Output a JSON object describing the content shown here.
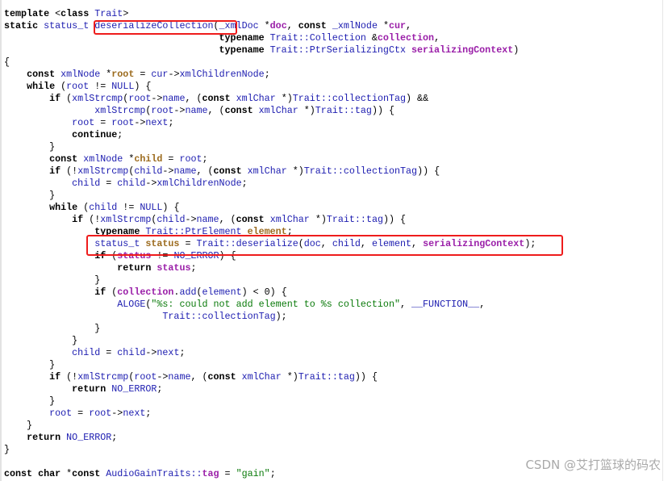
{
  "colors": {
    "keyword": "#000000",
    "identifier": "#1c1cb0",
    "parameter": "#9a1ea8",
    "local": "#9c6b1e",
    "string": "#0a7a0a",
    "highlight_box": "#ee1c1c"
  },
  "highlights": [
    "deserializeCollection",
    "status_t status = Trait::deserialize(doc, child, element, serializingContext);"
  ],
  "watermark": "CSDN @艾打篮球的码农",
  "lines": [
    [
      [
        "k",
        "template "
      ],
      [
        "o",
        "<"
      ],
      [
        "k",
        "class "
      ],
      [
        "t",
        "Trait"
      ],
      [
        "o",
        ">"
      ]
    ],
    [
      [
        "k",
        "static "
      ],
      [
        "t",
        "status_t "
      ],
      [
        "t",
        "deserializeCollection"
      ],
      [
        "o",
        "("
      ],
      [
        "t",
        "_xmlDoc "
      ],
      [
        "o",
        "*"
      ],
      [
        "p",
        "doc"
      ],
      [
        "o",
        ", "
      ],
      [
        "k",
        "const "
      ],
      [
        "t",
        "_xmlNode "
      ],
      [
        "o",
        "*"
      ],
      [
        "p",
        "cur"
      ],
      [
        "o",
        ","
      ]
    ],
    [
      [
        "o",
        "                                      "
      ],
      [
        "k",
        "typename "
      ],
      [
        "t",
        "Trait::Collection "
      ],
      [
        "o",
        "&"
      ],
      [
        "p",
        "collection"
      ],
      [
        "o",
        ","
      ]
    ],
    [
      [
        "o",
        "                                      "
      ],
      [
        "k",
        "typename "
      ],
      [
        "t",
        "Trait::PtrSerializingCtx "
      ],
      [
        "p",
        "serializingContext"
      ],
      [
        "o",
        ")"
      ]
    ],
    [
      [
        "o",
        "{"
      ]
    ],
    [
      [
        "o",
        "    "
      ],
      [
        "k",
        "const "
      ],
      [
        "t",
        "xmlNode "
      ],
      [
        "o",
        "*"
      ],
      [
        "v",
        "root"
      ],
      [
        "o",
        " = "
      ],
      [
        "t",
        "cur"
      ],
      [
        "o",
        "->"
      ],
      [
        "t",
        "xmlChildrenNode"
      ],
      [
        "o",
        ";"
      ]
    ],
    [
      [
        "o",
        "    "
      ],
      [
        "k",
        "while "
      ],
      [
        "o",
        "("
      ],
      [
        "t",
        "root"
      ],
      [
        "o",
        " != "
      ],
      [
        "t",
        "NULL"
      ],
      [
        "o",
        ") {"
      ]
    ],
    [
      [
        "o",
        "        "
      ],
      [
        "k",
        "if "
      ],
      [
        "o",
        "("
      ],
      [
        "t",
        "xmlStrcmp"
      ],
      [
        "o",
        "("
      ],
      [
        "t",
        "root"
      ],
      [
        "o",
        "->"
      ],
      [
        "t",
        "name"
      ],
      [
        "o",
        ", ("
      ],
      [
        "k",
        "const "
      ],
      [
        "t",
        "xmlChar "
      ],
      [
        "o",
        "*)"
      ],
      [
        "t",
        "Trait::collectionTag"
      ],
      [
        "o",
        ") &&"
      ]
    ],
    [
      [
        "o",
        "                "
      ],
      [
        "t",
        "xmlStrcmp"
      ],
      [
        "o",
        "("
      ],
      [
        "t",
        "root"
      ],
      [
        "o",
        "->"
      ],
      [
        "t",
        "name"
      ],
      [
        "o",
        ", ("
      ],
      [
        "k",
        "const "
      ],
      [
        "t",
        "xmlChar "
      ],
      [
        "o",
        "*)"
      ],
      [
        "t",
        "Trait::tag"
      ],
      [
        "o",
        ")) {"
      ]
    ],
    [
      [
        "o",
        "            "
      ],
      [
        "t",
        "root"
      ],
      [
        "o",
        " = "
      ],
      [
        "t",
        "root"
      ],
      [
        "o",
        "->"
      ],
      [
        "t",
        "next"
      ],
      [
        "o",
        ";"
      ]
    ],
    [
      [
        "o",
        "            "
      ],
      [
        "k",
        "continue"
      ],
      [
        "o",
        ";"
      ]
    ],
    [
      [
        "o",
        "        }"
      ]
    ],
    [
      [
        "o",
        "        "
      ],
      [
        "k",
        "const "
      ],
      [
        "t",
        "xmlNode "
      ],
      [
        "o",
        "*"
      ],
      [
        "v",
        "child"
      ],
      [
        "o",
        " = "
      ],
      [
        "t",
        "root"
      ],
      [
        "o",
        ";"
      ]
    ],
    [
      [
        "o",
        "        "
      ],
      [
        "k",
        "if "
      ],
      [
        "o",
        "(!"
      ],
      [
        "t",
        "xmlStrcmp"
      ],
      [
        "o",
        "("
      ],
      [
        "t",
        "child"
      ],
      [
        "o",
        "->"
      ],
      [
        "t",
        "name"
      ],
      [
        "o",
        ", ("
      ],
      [
        "k",
        "const "
      ],
      [
        "t",
        "xmlChar "
      ],
      [
        "o",
        "*)"
      ],
      [
        "t",
        "Trait::collectionTag"
      ],
      [
        "o",
        ")) {"
      ]
    ],
    [
      [
        "o",
        "            "
      ],
      [
        "t",
        "child"
      ],
      [
        "o",
        " = "
      ],
      [
        "t",
        "child"
      ],
      [
        "o",
        "->"
      ],
      [
        "t",
        "xmlChildrenNode"
      ],
      [
        "o",
        ";"
      ]
    ],
    [
      [
        "o",
        "        }"
      ]
    ],
    [
      [
        "o",
        "        "
      ],
      [
        "k",
        "while "
      ],
      [
        "o",
        "("
      ],
      [
        "t",
        "child"
      ],
      [
        "o",
        " != "
      ],
      [
        "t",
        "NULL"
      ],
      [
        "o",
        ") {"
      ]
    ],
    [
      [
        "o",
        "            "
      ],
      [
        "k",
        "if "
      ],
      [
        "o",
        "(!"
      ],
      [
        "t",
        "xmlStrcmp"
      ],
      [
        "o",
        "("
      ],
      [
        "t",
        "child"
      ],
      [
        "o",
        "->"
      ],
      [
        "t",
        "name"
      ],
      [
        "o",
        ", ("
      ],
      [
        "k",
        "const "
      ],
      [
        "t",
        "xmlChar "
      ],
      [
        "o",
        "*)"
      ],
      [
        "t",
        "Trait::tag"
      ],
      [
        "o",
        ")) {"
      ]
    ],
    [
      [
        "o",
        "                "
      ],
      [
        "k",
        "typename "
      ],
      [
        "t",
        "Trait::PtrElement "
      ],
      [
        "v",
        "element"
      ],
      [
        "o",
        ";"
      ]
    ],
    [
      [
        "o",
        "                "
      ],
      [
        "t",
        "status_t "
      ],
      [
        "v",
        "status"
      ],
      [
        "o",
        " = "
      ],
      [
        "t",
        "Trait::deserialize"
      ],
      [
        "o",
        "("
      ],
      [
        "t",
        "doc"
      ],
      [
        "o",
        ", "
      ],
      [
        "t",
        "child"
      ],
      [
        "o",
        ", "
      ],
      [
        "t",
        "element"
      ],
      [
        "o",
        ", "
      ],
      [
        "p",
        "serializingContext"
      ],
      [
        "o",
        ");"
      ]
    ],
    [
      [
        "o",
        "                "
      ],
      [
        "k",
        "if "
      ],
      [
        "o",
        "("
      ],
      [
        "p",
        "status"
      ],
      [
        "o",
        " != "
      ],
      [
        "t",
        "NO_ERROR"
      ],
      [
        "o",
        ") {"
      ]
    ],
    [
      [
        "o",
        "                    "
      ],
      [
        "k",
        "return "
      ],
      [
        "p",
        "status"
      ],
      [
        "o",
        ";"
      ]
    ],
    [
      [
        "o",
        "                }"
      ]
    ],
    [
      [
        "o",
        "                "
      ],
      [
        "k",
        "if "
      ],
      [
        "o",
        "("
      ],
      [
        "p",
        "collection"
      ],
      [
        "o",
        "."
      ],
      [
        "t",
        "add"
      ],
      [
        "o",
        "("
      ],
      [
        "t",
        "element"
      ],
      [
        "o",
        ") < 0) {"
      ]
    ],
    [
      [
        "o",
        "                    "
      ],
      [
        "t",
        "ALOGE"
      ],
      [
        "o",
        "("
      ],
      [
        "s",
        "\"%s: could not add element to %s collection\""
      ],
      [
        "o",
        ", "
      ],
      [
        "t",
        "__FUNCTION__"
      ],
      [
        "o",
        ","
      ]
    ],
    [
      [
        "o",
        "                            "
      ],
      [
        "t",
        "Trait::collectionTag"
      ],
      [
        "o",
        ");"
      ]
    ],
    [
      [
        "o",
        "                }"
      ]
    ],
    [
      [
        "o",
        "            }"
      ]
    ],
    [
      [
        "o",
        "            "
      ],
      [
        "t",
        "child"
      ],
      [
        "o",
        " = "
      ],
      [
        "t",
        "child"
      ],
      [
        "o",
        "->"
      ],
      [
        "t",
        "next"
      ],
      [
        "o",
        ";"
      ]
    ],
    [
      [
        "o",
        "        }"
      ]
    ],
    [
      [
        "o",
        "        "
      ],
      [
        "k",
        "if "
      ],
      [
        "o",
        "(!"
      ],
      [
        "t",
        "xmlStrcmp"
      ],
      [
        "o",
        "("
      ],
      [
        "t",
        "root"
      ],
      [
        "o",
        "->"
      ],
      [
        "t",
        "name"
      ],
      [
        "o",
        ", ("
      ],
      [
        "k",
        "const "
      ],
      [
        "t",
        "xmlChar "
      ],
      [
        "o",
        "*)"
      ],
      [
        "t",
        "Trait::tag"
      ],
      [
        "o",
        ")) {"
      ]
    ],
    [
      [
        "o",
        "            "
      ],
      [
        "k",
        "return "
      ],
      [
        "t",
        "NO_ERROR"
      ],
      [
        "o",
        ";"
      ]
    ],
    [
      [
        "o",
        "        }"
      ]
    ],
    [
      [
        "o",
        "        "
      ],
      [
        "t",
        "root"
      ],
      [
        "o",
        " = "
      ],
      [
        "t",
        "root"
      ],
      [
        "o",
        "->"
      ],
      [
        "t",
        "next"
      ],
      [
        "o",
        ";"
      ]
    ],
    [
      [
        "o",
        "    }"
      ]
    ],
    [
      [
        "o",
        "    "
      ],
      [
        "k",
        "return "
      ],
      [
        "t",
        "NO_ERROR"
      ],
      [
        "o",
        ";"
      ]
    ],
    [
      [
        "o",
        "}"
      ]
    ],
    [],
    [
      [
        "k",
        "const char "
      ],
      [
        "o",
        "*"
      ],
      [
        "k",
        "const "
      ],
      [
        "t",
        "AudioGainTraits::"
      ],
      [
        "p",
        "tag"
      ],
      [
        "o",
        " = "
      ],
      [
        "s",
        "\"gain\""
      ],
      [
        "o",
        ";"
      ]
    ]
  ]
}
